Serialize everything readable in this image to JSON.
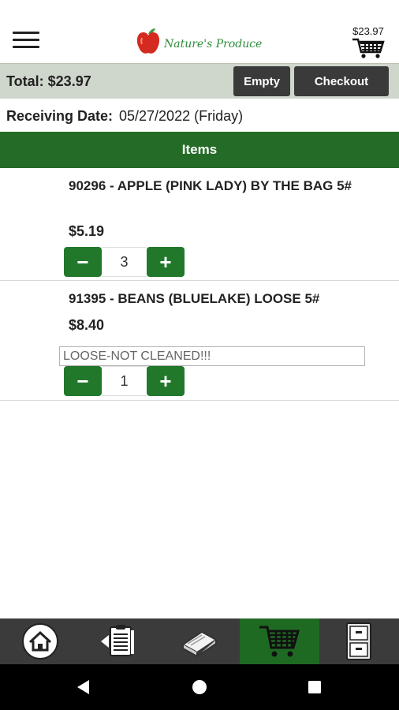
{
  "header": {
    "brand": "Nature's Produce",
    "cart_total": "$23.97"
  },
  "total_bar": {
    "total_text": "Total:  $23.97",
    "empty_label": "Empty",
    "checkout_label": "Checkout"
  },
  "receiving": {
    "label": "Receiving Date:",
    "value": "05/27/2022 (Friday)"
  },
  "items_header": "Items",
  "items": [
    {
      "title": "90296 - APPLE (PINK LADY) BY THE BAG 5#",
      "price": "$5.19",
      "quantity": "3",
      "note": ""
    },
    {
      "title": "91395 - BEANS (BLUELAKE) LOOSE 5#",
      "price": "$8.40",
      "quantity": "1",
      "note": "LOOSE-NOT CLEANED!!!"
    }
  ],
  "qty_controls": {
    "minus": "−",
    "plus": "+"
  },
  "bottom_nav": {
    "icons": [
      "home-icon",
      "clipboard-icon",
      "catalog-icon",
      "cart-icon",
      "cabinet-icon"
    ],
    "active_index": 3
  },
  "colors": {
    "brand_green": "#246b27",
    "button_green": "#22782a",
    "dark_button": "#3a3a3a",
    "total_bar": "#cfd6cb",
    "nav_bg": "#3b3b3b"
  }
}
